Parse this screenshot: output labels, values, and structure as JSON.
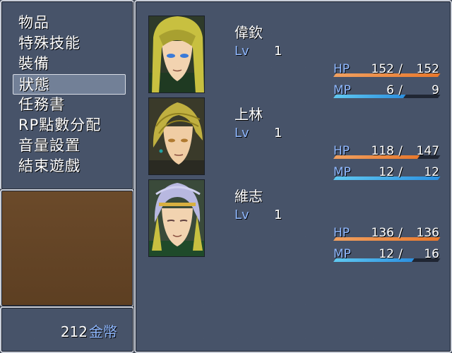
{
  "menu": {
    "items": [
      {
        "label": "物品"
      },
      {
        "label": "特殊技能"
      },
      {
        "label": "裝備"
      },
      {
        "label": "狀態"
      },
      {
        "label": "任務書"
      },
      {
        "label": "RP點數分配"
      },
      {
        "label": "音量設置"
      },
      {
        "label": "結束遊戲"
      }
    ],
    "selected_index": 3
  },
  "gold": {
    "amount": "212",
    "unit": "金幣"
  },
  "labels": {
    "lv": "Lv",
    "hp": "HP",
    "mp": "MP",
    "slash": "/"
  },
  "party": [
    {
      "name": "偉欽",
      "lv": "1",
      "hp": "152",
      "hp_max": "152",
      "mp": "6",
      "mp_max": "9",
      "portrait": "blonde-long-hair-portrait",
      "hair_color": "#c8c040",
      "eye_color": "#3a7ad8"
    },
    {
      "name": "上林",
      "lv": "1",
      "hp": "118",
      "hp_max": "147",
      "mp": "12",
      "mp_max": "12",
      "portrait": "blonde-swept-hair-portrait",
      "hair_color": "#c0b040",
      "eye_color": "#b07a30"
    },
    {
      "name": "維志",
      "lv": "1",
      "hp": "136",
      "hp_max": "136",
      "mp": "12",
      "mp_max": "16",
      "portrait": "silver-hair-headband-portrait",
      "hair_color": "#b8b8e0",
      "eye_color": "#604040"
    }
  ],
  "colors": {
    "accent": "#8fb8ff",
    "hp_bar": "#e8782c",
    "mp_bar": "#2c90e0"
  }
}
